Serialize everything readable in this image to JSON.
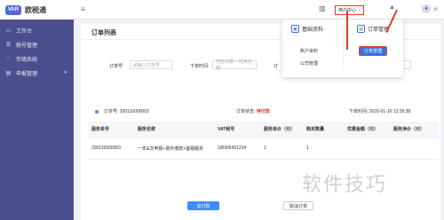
{
  "brand": {
    "logo": "VAR",
    "name": "欧税通"
  },
  "sidebar": {
    "items": [
      {
        "label": "工作台",
        "icon": "monitor-icon"
      },
      {
        "label": "税号管理",
        "icon": "document-icon"
      },
      {
        "label": "伴随系统",
        "icon": "bulb-icon"
      },
      {
        "label": "申报管理",
        "icon": "list-icon"
      }
    ]
  },
  "topbar": {
    "user_center": "用户中心",
    "user_name": "计"
  },
  "page": {
    "title": "订单列表"
  },
  "filters": {
    "order_no_label": "订单号:",
    "order_no_placeholder": "请输入订单号",
    "order_time_label": "下单时间:",
    "order_time_placeholder": "开始日期 ~ 结束日期",
    "order_status_label": "订"
  },
  "order_info": {
    "order_no": "订单号: 200116000003",
    "status_label": "订单状态:",
    "status_value": "待付款",
    "order_time": "下单时间: 2020-01-16 13:39:38"
  },
  "table": {
    "headers": [
      "服务单号",
      "服务名称",
      "VAT税号",
      "服务单价（元）",
      "购买数量",
      "优惠金额（元）",
      "服务净价（元）"
    ],
    "rows": [
      [
        "200116000003",
        "一年&次申报+境外缴款+客服服务",
        "GB995421234",
        "1",
        "1",
        "",
        ""
      ]
    ]
  },
  "actions": {
    "pay": "去付款",
    "cancel": "取消订单"
  },
  "dropdown": {
    "basic_info": "基础资料",
    "order_management": "订单管理",
    "account_info": "账户资料",
    "company_management": "公司管理",
    "order_management_btn": "订单管理"
  },
  "watermark": "软件技巧",
  "colors": {
    "accent": "#3b73d9",
    "sidebar": "#4b4f8d",
    "alert": "#e03b2e"
  }
}
